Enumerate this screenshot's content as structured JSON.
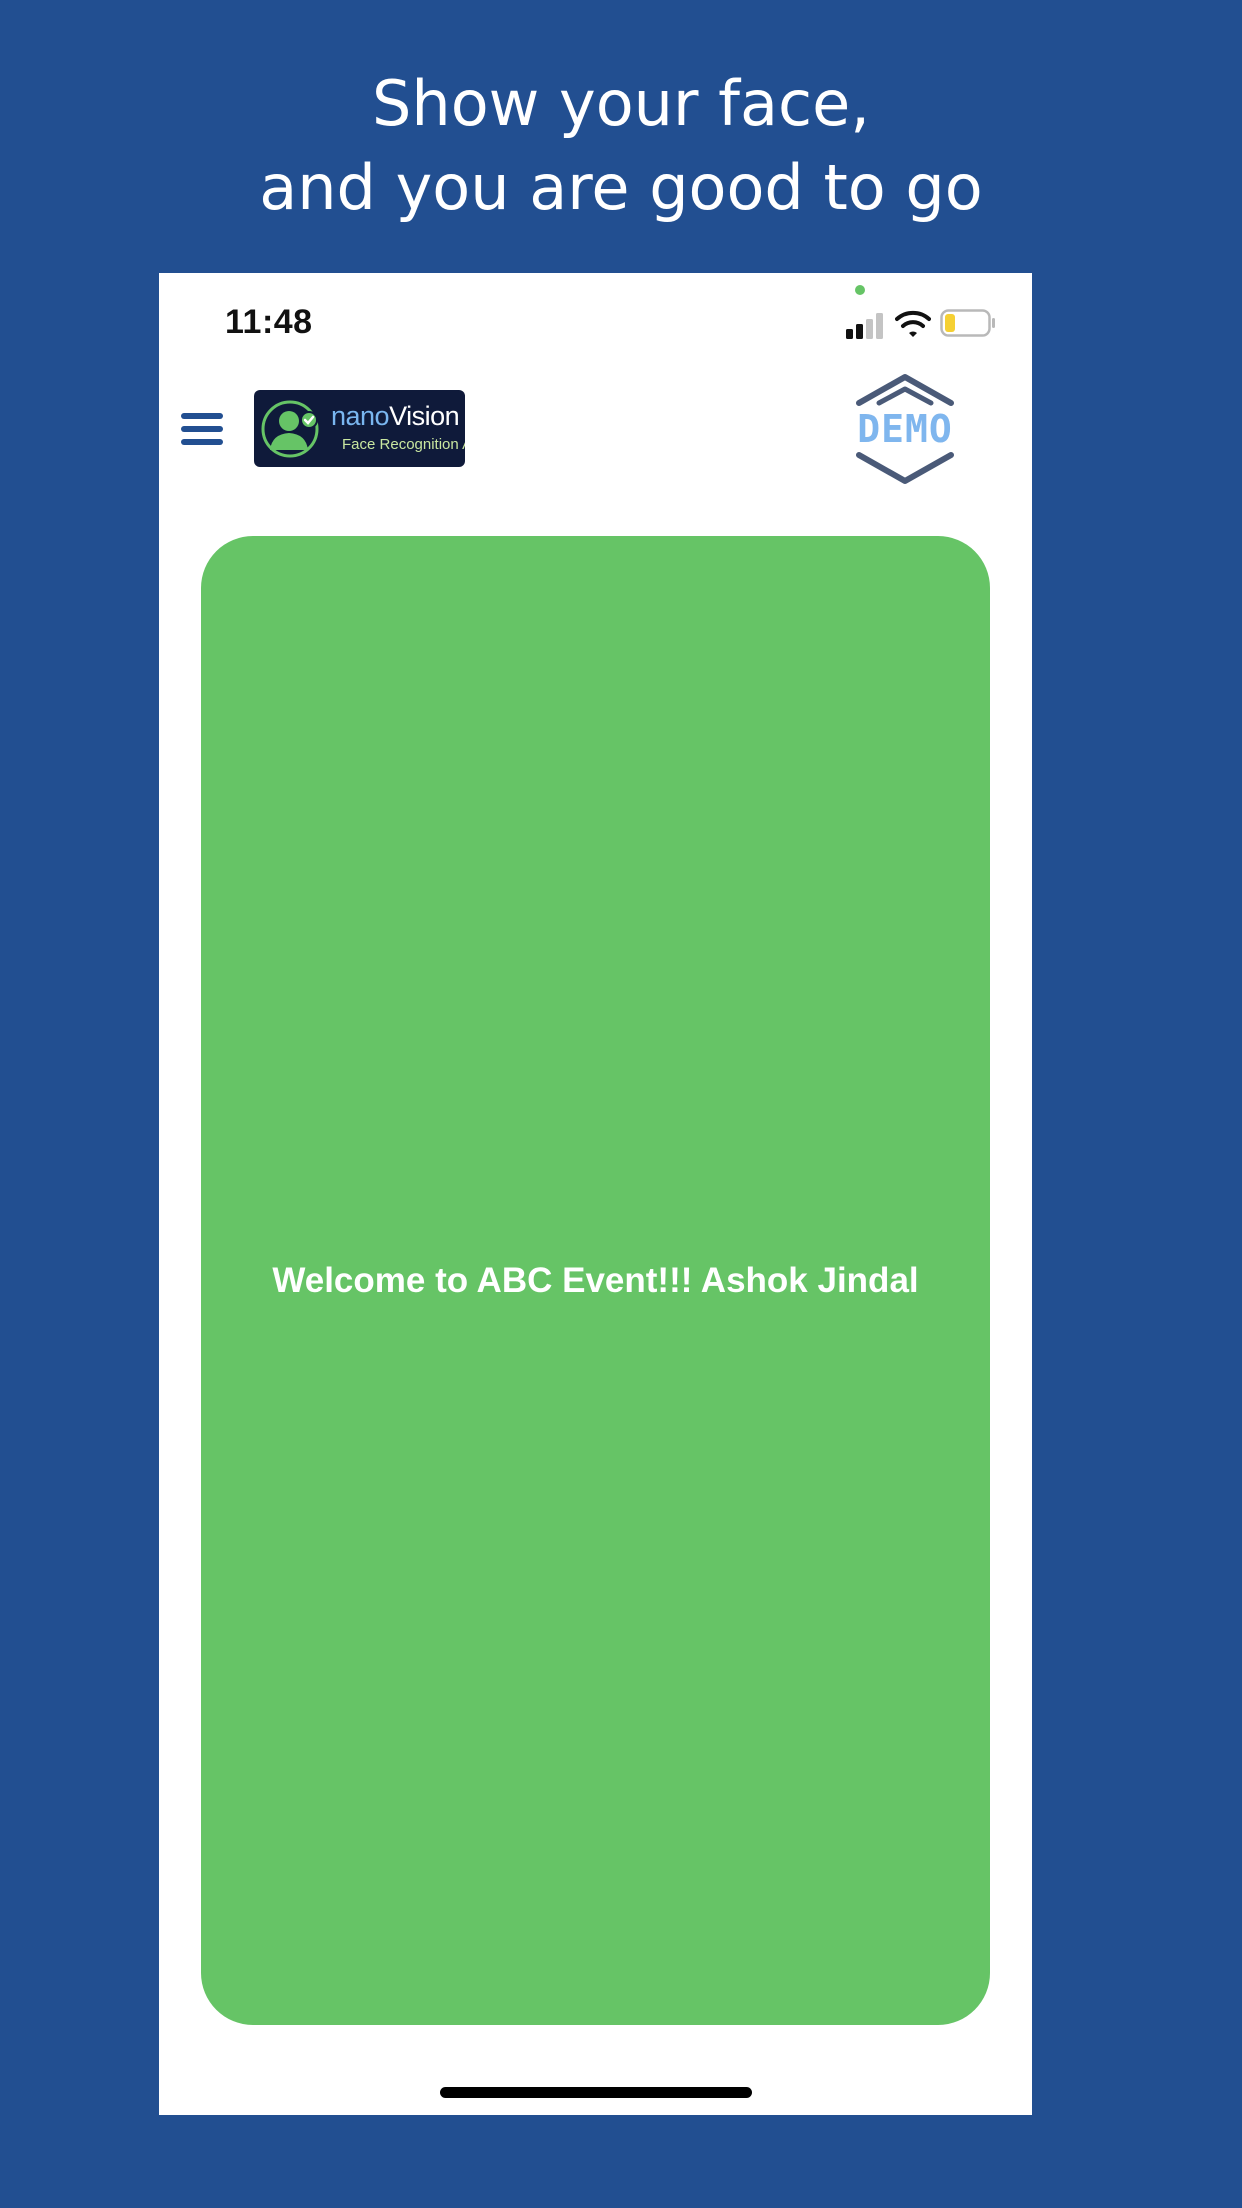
{
  "promo": {
    "line1": "Show your face,",
    "line2": "and you are good to go",
    "background_color": "#224f91"
  },
  "status_bar": {
    "time": "11:48",
    "camera_indicator_color": "#66c466",
    "battery_color": "#f5d033",
    "battery_level": 0.25,
    "signal_bars_active": 2,
    "signal_bars_total": 4,
    "icons": [
      "signal-icon",
      "wifi-icon",
      "battery-icon"
    ]
  },
  "header": {
    "menu_icon": "hamburger-menu-icon",
    "brand": {
      "name_prefix": "nano",
      "name_suffix": "Vision",
      "tagline": "Face Recognition AI",
      "logo_background": "#0f1a3a",
      "accent_color": "#66c466"
    },
    "badge": {
      "label": "DEMO",
      "text_color": "#7fb6ee",
      "frame_color": "#4a5a78"
    }
  },
  "card": {
    "message": "Welcome to ABC Event!!! Ashok Jindal",
    "background_color": "#66c466"
  }
}
